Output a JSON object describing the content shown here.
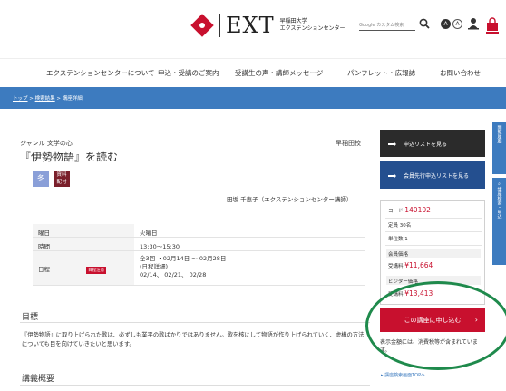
{
  "header": {
    "logo_text": "EXT",
    "logo_sub_line1": "早稲田大学",
    "logo_sub_line2": "エクステンションセンター",
    "search_placeholder": "Google カスタム検索",
    "circle_dark": "A",
    "circle_light": "A",
    "accent_color": "#c8102e"
  },
  "nav": {
    "items": [
      "エクステンションセンターについて",
      "申込・受講のご案内",
      "受講生の声・講師メッセージ",
      "パンフレット・広報誌",
      "お問い合わせ"
    ]
  },
  "breadcrumb": {
    "items": [
      "トップ",
      "検索結果",
      "講座詳細"
    ],
    "separator": ">"
  },
  "course": {
    "genre": "ジャンル 文学の心",
    "school": "早稲田校",
    "title": "『伊勢物語』を読む",
    "season_badge": "冬",
    "material_badge_1": "資料",
    "material_badge_2": "配付",
    "instructor": "田坂 千恵子（エクステンションセンター講師）",
    "info": {
      "weekday_label": "曜日",
      "weekday_value": "火曜日",
      "time_label": "時間",
      "time_value": "13:30〜15:30",
      "schedule_label": "日程",
      "schedule_tag": "日程注意",
      "schedule_line1": "全3回 ・02月14日 〜 02月28日",
      "schedule_line2": "(日程詳細)",
      "schedule_line3": "02/14、 02/21、 02/28"
    },
    "objective_title": "目標",
    "objective_text": "『伊勢物語』に取り上げられた歌は、必ずしも業平の歌ばかりではありません。歌を核にして物語が作り上げられていく、虚構の方法についても目を向けていきたいと思います。",
    "overview_title": "講義概要"
  },
  "side": {
    "list_button": "申込リストを見る",
    "member_button": "会員先行申込リストを見る",
    "code_label": "コード",
    "code_value": "140102",
    "capacity": "定員 30名",
    "units": "単位数 1",
    "member_price_label": "会員価格",
    "member_fee_label": "受講料",
    "member_fee_value": "¥11,664",
    "visitor_price_label": "ビジター価格",
    "visitor_fee_label": "受講料",
    "visitor_fee_value": "¥13,413",
    "apply_button": "この講座に申し込む",
    "apply_chevron": "›",
    "tax_note": "表示金額には、消費税等が含まれています。",
    "top_link": "講座検索画面TOPへ",
    "tab1": "閲覧履歴",
    "tab2": "講座検索・申込"
  }
}
